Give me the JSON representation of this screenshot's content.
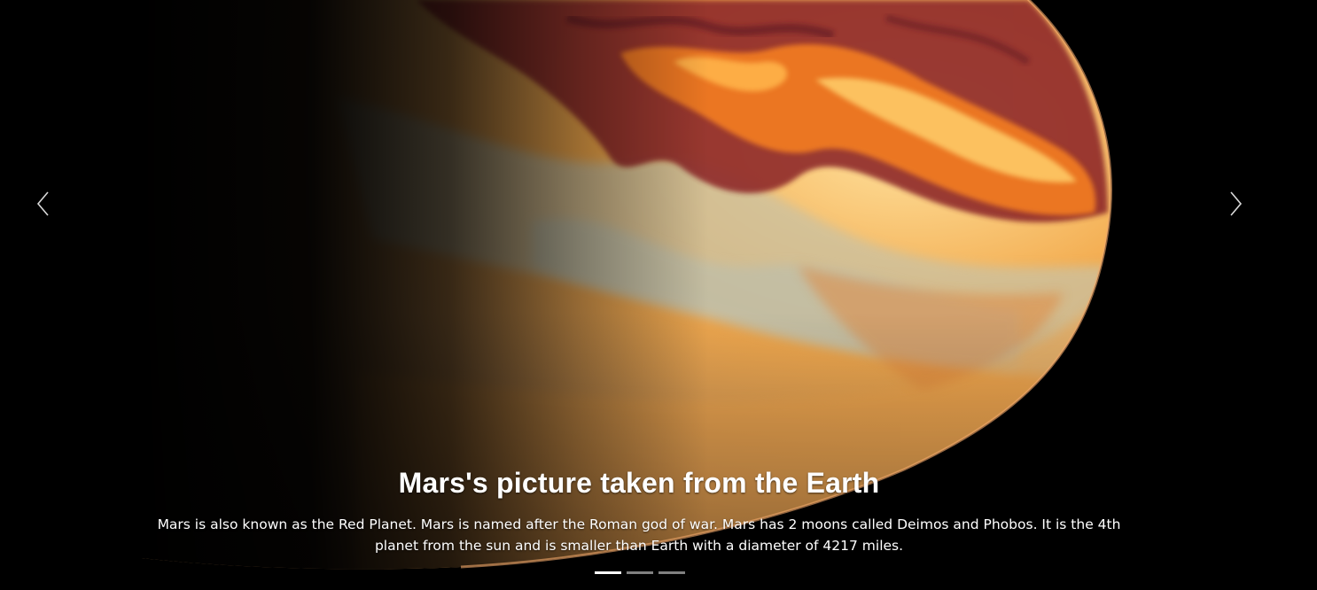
{
  "carousel": {
    "slide": {
      "title": "Mars's picture taken from the Earth",
      "description": "Mars is also known as the Red Planet. Mars is named after the Roman god of war. Mars has 2 moons called Deimos and Phobos. It is the 4th planet from the sun and is smaller than Earth with a diameter of 4217 miles."
    },
    "controls": {
      "prev_icon": "chevron-left-icon",
      "next_icon": "chevron-right-icon"
    },
    "indicators": [
      {
        "active": true
      },
      {
        "active": false
      },
      {
        "active": false
      }
    ]
  },
  "colors": {
    "background": "#000000",
    "planet_light": "#f0c77a",
    "planet_orange": "#e8792a",
    "planet_red": "#8e2e2c",
    "caption_text": "#ffffff"
  }
}
